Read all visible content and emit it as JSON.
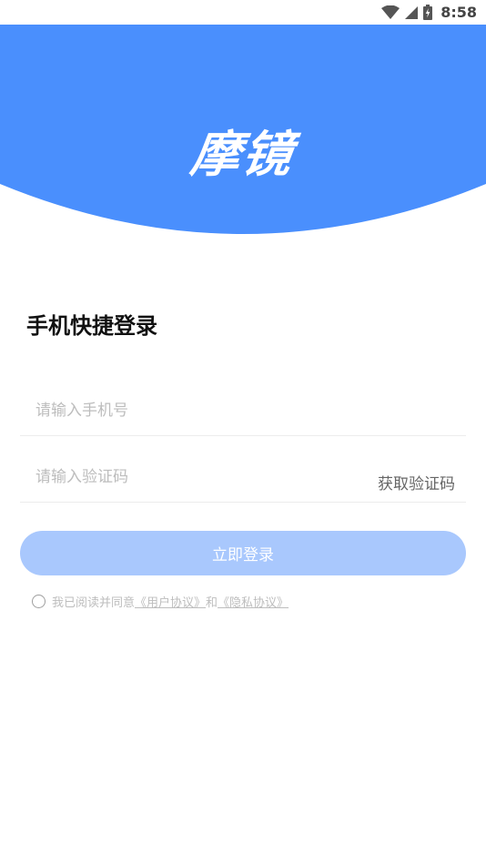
{
  "status_bar": {
    "time": "8:58",
    "icons": [
      "wifi-icon",
      "cell-signal-icon",
      "battery-icon"
    ]
  },
  "header": {
    "logo_text": "摩镜",
    "background_color": "#4a8ffd"
  },
  "login": {
    "title": "手机快捷登录",
    "phone_placeholder": "请输入手机号",
    "code_placeholder": "请输入验证码",
    "get_code_label": "获取验证码",
    "submit_label": "立即登录",
    "submit_color": "#a9c8fd"
  },
  "agreement": {
    "prefix": "我已阅读并同意",
    "user_agreement": "《用户协议》",
    "conjunction": "和",
    "privacy_policy": "《隐私协议》"
  }
}
